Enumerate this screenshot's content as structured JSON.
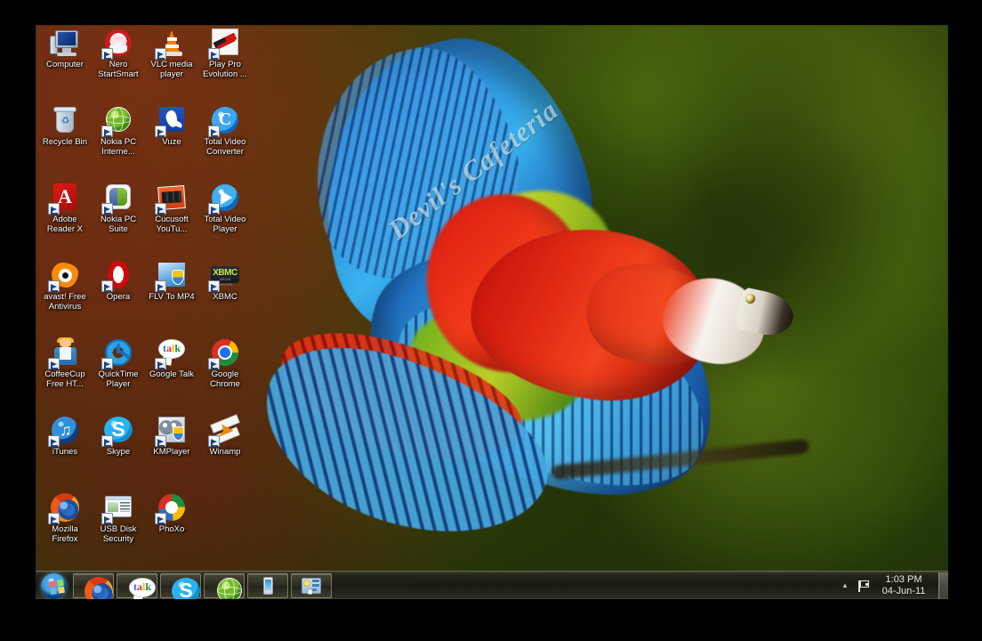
{
  "desktop": {
    "wallpaper_description": "blurred green foliage bokeh with scarlet macaw in flight",
    "watermark": "Devil's Cafeteria",
    "icons": [
      {
        "label": "Computer",
        "icon": "computer-icon",
        "shortcut": false
      },
      {
        "label": "Nero StartSmart",
        "icon": "nero-startsmart-icon",
        "shortcut": true
      },
      {
        "label": "VLC media player",
        "icon": "vlc-media-player-icon",
        "shortcut": true
      },
      {
        "label": "Play Pro Evolution ...",
        "icon": "play-pro-evolution-icon",
        "shortcut": true
      },
      {
        "label": "Recycle Bin",
        "icon": "recycle-bin-icon",
        "shortcut": false
      },
      {
        "label": "Nokia PC Interne...",
        "icon": "nokia-pc-internet-icon",
        "shortcut": true
      },
      {
        "label": "Vuze",
        "icon": "vuze-icon",
        "shortcut": true
      },
      {
        "label": "Total Video Converter",
        "icon": "total-video-converter-icon",
        "shortcut": true
      },
      {
        "label": "Adobe Reader X",
        "icon": "adobe-reader-icon",
        "shortcut": true
      },
      {
        "label": "Nokia PC Suite",
        "icon": "nokia-pc-suite-icon",
        "shortcut": true
      },
      {
        "label": "Cucusoft YouTu...",
        "icon": "cucusoft-youtube-icon",
        "shortcut": true
      },
      {
        "label": "Total Video Player",
        "icon": "total-video-player-icon",
        "shortcut": true
      },
      {
        "label": "avast! Free Antivirus",
        "icon": "avast-antivirus-icon",
        "shortcut": true
      },
      {
        "label": "Opera",
        "icon": "opera-icon",
        "shortcut": true
      },
      {
        "label": "FLV To MP4",
        "icon": "flv-to-mp4-icon",
        "shortcut": true
      },
      {
        "label": "XBMC",
        "icon": "xbmc-icon",
        "shortcut": true
      },
      {
        "label": "CoffeeCup Free HT...",
        "icon": "coffeecup-icon",
        "shortcut": true
      },
      {
        "label": "QuickTime Player",
        "icon": "quicktime-player-icon",
        "shortcut": true
      },
      {
        "label": "Google Talk",
        "icon": "google-talk-icon",
        "shortcut": true
      },
      {
        "label": "Google Chrome",
        "icon": "google-chrome-icon",
        "shortcut": true
      },
      {
        "label": "iTunes",
        "icon": "itunes-icon",
        "shortcut": true
      },
      {
        "label": "Skype",
        "icon": "skype-icon",
        "shortcut": true
      },
      {
        "label": "KMPlayer",
        "icon": "kmplayer-icon",
        "shortcut": true
      },
      {
        "label": "Winamp",
        "icon": "winamp-icon",
        "shortcut": true
      },
      {
        "label": "Mozilla Firefox",
        "icon": "mozilla-firefox-icon",
        "shortcut": true
      },
      {
        "label": "USB Disk Security",
        "icon": "usb-disk-security-icon",
        "shortcut": true
      },
      {
        "label": "PhoXo",
        "icon": "phoxo-icon",
        "shortcut": true
      }
    ]
  },
  "taskbar": {
    "start_button": {
      "label": "Start",
      "icon": "windows-start-orb-icon"
    },
    "buttons": [
      {
        "label": "Mozilla Firefox",
        "icon": "mozilla-firefox-icon"
      },
      {
        "label": "Google Talk",
        "icon": "google-talk-icon"
      },
      {
        "label": "Skype",
        "icon": "skype-icon"
      },
      {
        "label": "Nokia PC Internet",
        "icon": "nokia-pc-internet-icon"
      },
      {
        "label": "Phone",
        "icon": "mobile-phone-icon"
      },
      {
        "label": "Nokia PC Suite",
        "icon": "nokia-pc-suite-icon"
      }
    ],
    "tray": {
      "show_hidden_icons": "▲",
      "action_center": {
        "label": "Action Center",
        "icon": "flag-icon"
      },
      "clock": {
        "time": "1:03 PM",
        "date": "04-Jun-11"
      },
      "show_desktop": {
        "label": "Show desktop"
      }
    }
  },
  "colors": {
    "taskbar_bg": "#1a1c14",
    "start_orb": "#1768b8",
    "icon_label_text": "#ffffff",
    "clock_text": "#eef2e6",
    "letterbox": "#000000"
  }
}
